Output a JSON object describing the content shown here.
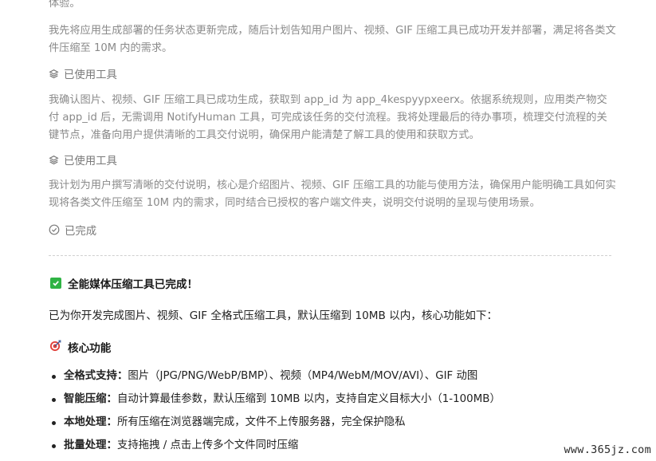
{
  "log": {
    "top_fragment": "体验。",
    "para1": "我先将应用生成部署的任务状态更新完成，随后计划告知用户图片、视频、GIF 压缩工具已成功开发并部署，满足将各类文件压缩至 10M 内的需求。",
    "tool_used_1": "已使用工具",
    "para2": "我确认图片、视频、GIF 压缩工具已成功生成，获取到 app_id 为 app_4kespyypxeerx。依据系统规则，应用类产物交付 app_id 后，无需调用 NotifyHuman 工具，可完成该任务的交付流程。我将处理最后的待办事项，梳理交付流程的关键节点，准备向用户提供清晰的工具交付说明，确保用户能清楚了解工具的使用和获取方式。",
    "tool_used_2": "已使用工具",
    "para3": "我计划为用户撰写清晰的交付说明，核心是介绍图片、视频、GIF 压缩工具的功能与使用方法，确保用户能明确工具如何实现将各类文件压缩至 10M 内的需求，同时结合已授权的客户端文件夹，说明交付说明的呈现与使用场景。",
    "completed": "已完成"
  },
  "result": {
    "title": "全能媒体压缩工具已完成！",
    "intro": "已为你开发完成图片、视频、GIF 全格式压缩工具，默认压缩到 10MB 以内，核心功能如下：",
    "section_title": "核心功能",
    "features": [
      {
        "label": "全格式支持：",
        "text": "图片（JPG/PNG/WebP/BMP）、视频（MP4/WebM/MOV/AVI）、GIF 动图"
      },
      {
        "label": "智能压缩：",
        "text": "自动计算最佳参数，默认压缩到 10MB 以内，支持自定义目标大小（1-100MB）"
      },
      {
        "label": "本地处理：",
        "text": "所有压缩在浏览器端完成，文件不上传服务器，完全保护隐私"
      },
      {
        "label": "批量处理：",
        "text": "支持拖拽 / 点击上传多个文件同时压缩"
      }
    ]
  },
  "watermark": "www.365jz.com",
  "colors": {
    "check_green": "#2fb344",
    "muted_text": "#8a8a8a",
    "target_red": "#e0403a"
  },
  "icons": {
    "tool": "layers-icon",
    "completed": "check-circle-icon",
    "done": "check-square-icon",
    "section": "target-icon"
  }
}
